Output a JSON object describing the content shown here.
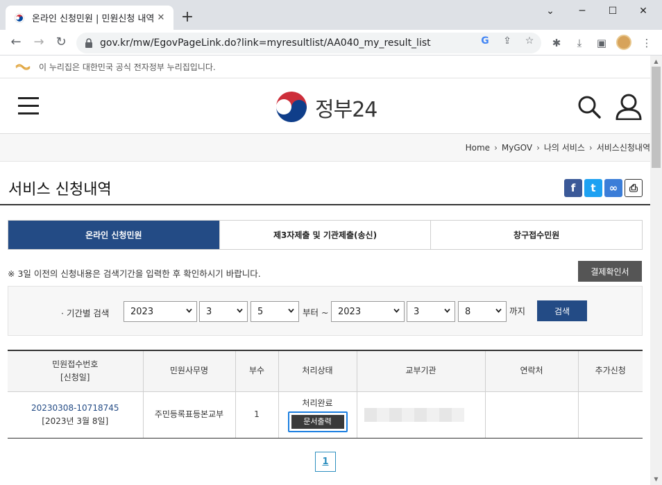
{
  "browser": {
    "tab_title": "온라인 신청민원 | 민원신청 내역",
    "url": "gov.kr/mw/EgovPageLink.do?link=myresultlist/AA040_my_result_list"
  },
  "notice": {
    "text": "이 누리집은 대한민국 공식 전자정부 누리집입니다."
  },
  "header": {
    "logo_text": "정부24"
  },
  "breadcrumb": [
    "Home",
    "MyGOV",
    "나의 서비스",
    "서비스신청내역"
  ],
  "page_title": "서비스 신청내역",
  "share": {
    "facebook": "f",
    "twitter": "t",
    "link": "∞",
    "print": "⎙"
  },
  "tabs": [
    "온라인 신청민원",
    "제3자제출 및 기관제출(송신)",
    "창구접수민원"
  ],
  "hint": "※ 3일 이전의 신청내용은 검색기간을 입력한 후 확인하시기 바랍니다.",
  "confirm_button": "결제확인서",
  "search": {
    "label": "· 기간별 검색",
    "start_year": "2023",
    "start_month": "3",
    "start_day": "5",
    "from_text": "부터 ~",
    "end_year": "2023",
    "end_month": "3",
    "end_day": "8",
    "until_text": "까지",
    "button": "검색"
  },
  "table": {
    "headers": [
      "민원접수번호",
      "[신청일]",
      "민원사무명",
      "부수",
      "처리상태",
      "교부기관",
      "연락처",
      "추가신청"
    ],
    "row": {
      "receipt_no": "20230308-10718745",
      "date": "[2023년 3월 8일]",
      "service": "주민등록표등본교부",
      "copies": "1",
      "status": "처리완료",
      "print_button": "문서출력"
    }
  },
  "pagination": {
    "current": "1"
  },
  "colors": {
    "primary": "#234b85",
    "highlight": "#1a7ee0"
  }
}
